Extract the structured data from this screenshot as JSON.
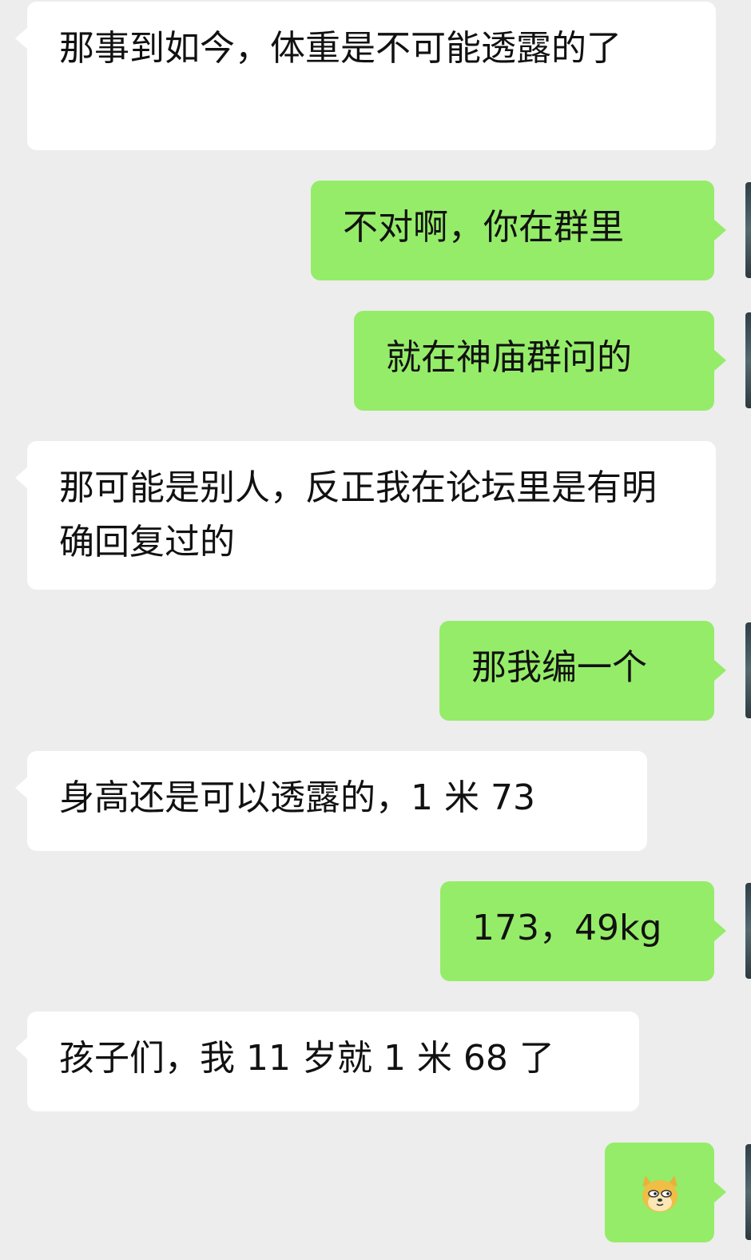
{
  "messages": [
    {
      "side": "in",
      "text": "那事到如今，体重是不可能透露的了"
    },
    {
      "side": "out",
      "text": "不对啊，你在群里"
    },
    {
      "side": "out",
      "text": "就在神庙群问的"
    },
    {
      "side": "in",
      "text": "那可能是别人，反正我在论坛里是有明确回复过的"
    },
    {
      "side": "out",
      "text": "那我编一个"
    },
    {
      "side": "in",
      "text": "身高还是可以透露的，1 米 73"
    },
    {
      "side": "out",
      "text": "173，49kg"
    },
    {
      "side": "in",
      "text": "孩子们，我 11 岁就 1 米 68 了"
    },
    {
      "side": "out",
      "emoji": "doge-emoji"
    }
  ],
  "colors": {
    "background": "#ededed",
    "incoming_bubble": "#ffffff",
    "outgoing_bubble": "#95ec69",
    "text": "#111111"
  }
}
